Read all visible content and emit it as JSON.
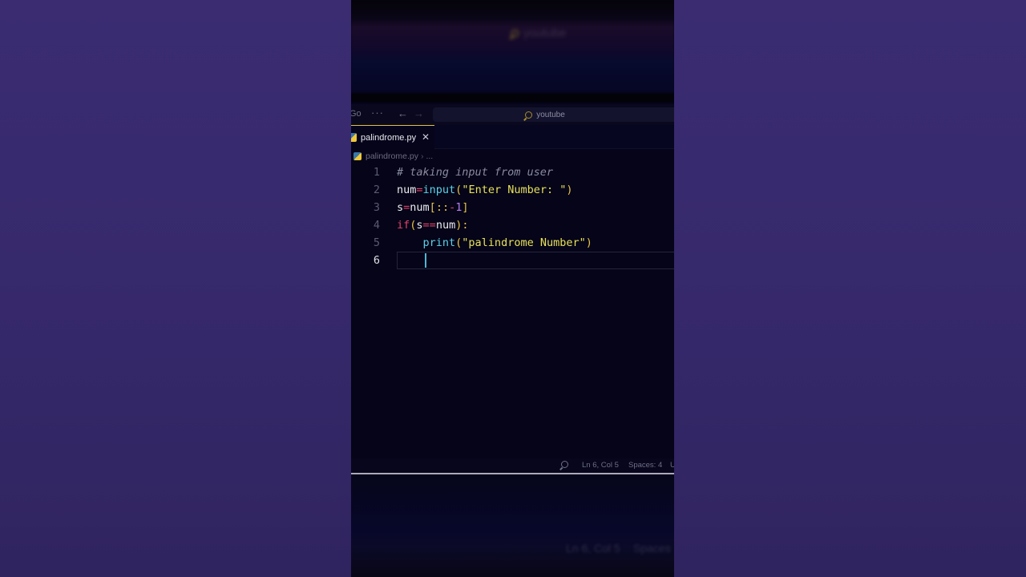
{
  "titlebar": {
    "go_label": "Go",
    "more_label": "···",
    "back_arrow": "←",
    "forward_arrow": "→",
    "search_text": "youtube"
  },
  "tab": {
    "filename": "palindrome.py",
    "close_symbol": "✕"
  },
  "breadcrumb": {
    "file": "palindrome.py",
    "separator": "›",
    "rest": "..."
  },
  "editor": {
    "active_line": 6,
    "lines": [
      {
        "number": "1",
        "text": "# taking input from user"
      },
      {
        "number": "2",
        "text": "num=input(\"Enter Number: \")"
      },
      {
        "number": "3",
        "text": "s=num[::-1]"
      },
      {
        "number": "4",
        "text": "if(s==num):"
      },
      {
        "number": "5",
        "text": "    print(\"palindrome Number\")"
      },
      {
        "number": "6",
        "text": "    "
      }
    ]
  },
  "statusbar": {
    "position": "Ln 6, Col 5",
    "spaces": "Spaces: 4",
    "encoding_fragment": "U"
  },
  "background_blur": {
    "top_search": "youtube",
    "bottom_position": "Ln 6, Col 5",
    "bottom_spaces": "Spaces"
  },
  "colors": {
    "background": "#3a2a70",
    "editor_bg": "#050418",
    "tab_accent": "#e0c14a",
    "comment": "#8a8aa2",
    "operator": "#e0436a",
    "function": "#5cd0e8",
    "string": "#e8e15a",
    "number": "#b47ef0",
    "caret": "#4fb6d6"
  }
}
